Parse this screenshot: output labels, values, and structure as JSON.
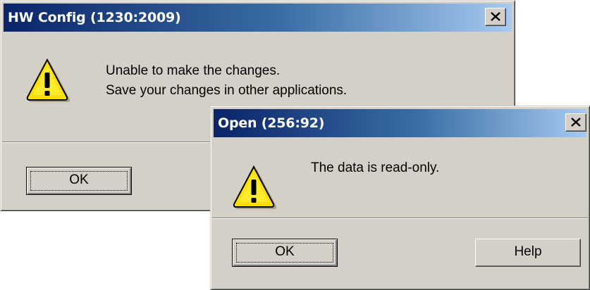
{
  "dialog_hwconfig": {
    "title": "HW Config (1230:2009)",
    "icon": "warning-icon",
    "message_line1": "Unable to make the changes.",
    "message_line2": "Save your changes in other applications.",
    "ok_label": "OK",
    "close_icon": "close-icon"
  },
  "dialog_open": {
    "title": "Open (256:92)",
    "icon": "warning-icon",
    "message": "The data is read-only.",
    "ok_label": "OK",
    "help_label": "Help",
    "close_icon": "close-icon"
  },
  "colors": {
    "face": "#d4d0c8",
    "title_start": "#0a246a",
    "title_end": "#a6caf0",
    "warning_yellow": "#ffd700"
  }
}
